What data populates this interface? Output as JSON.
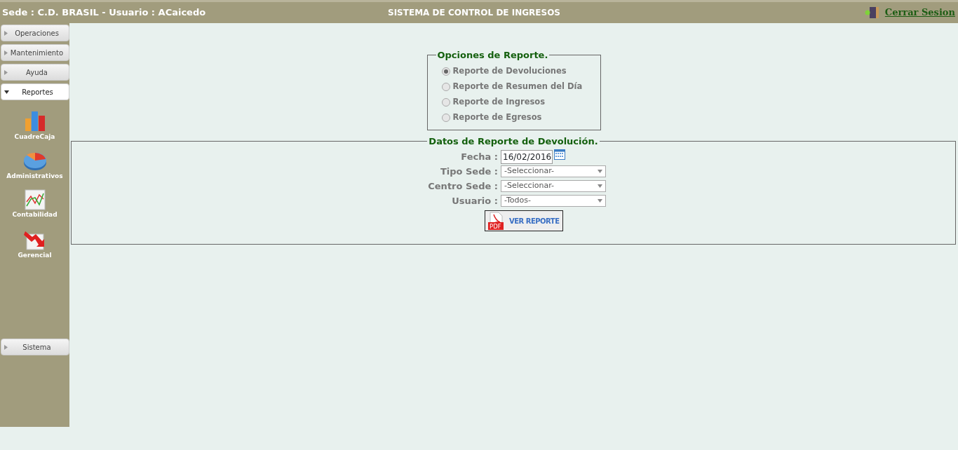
{
  "header": {
    "session": "Sede : C.D. BRASIL - Usuario : ACaicedo",
    "title": "SISTEMA DE CONTROL DE INGRESOS",
    "logout": "Cerrar Sesion"
  },
  "sidebar": {
    "sections": [
      {
        "label": "Operaciones",
        "expanded": false
      },
      {
        "label": "Mantenimiento",
        "expanded": false
      },
      {
        "label": "Ayuda",
        "expanded": false
      },
      {
        "label": "Reportes",
        "expanded": true,
        "items": [
          {
            "label": "CuadreCaja",
            "kind": "bars"
          },
          {
            "label": "Administrativos",
            "kind": "pie"
          },
          {
            "label": "Contabilidad",
            "kind": "line"
          },
          {
            "label": "Gerencial",
            "kind": "down"
          }
        ]
      }
    ],
    "bottom": {
      "label": "Sistema",
      "expanded": false
    }
  },
  "options": {
    "legend": "Opciones de Reporte.",
    "radios": [
      {
        "label": "Reporte de Devoluciones",
        "selected": true
      },
      {
        "label": "Reporte de Resumen del Día",
        "selected": false
      },
      {
        "label": "Reporte de Ingresos",
        "selected": false
      },
      {
        "label": "Reporte de Egresos",
        "selected": false
      }
    ]
  },
  "form": {
    "legend": "Datos de Reporte de Devolución.",
    "fields": [
      {
        "label": "Fecha :",
        "kind": "date",
        "value": "16/02/2016"
      },
      {
        "label": "Tipo Sede :",
        "kind": "select",
        "value": "-Seleccionar-"
      },
      {
        "label": "Centro Sede :",
        "kind": "select",
        "value": "-Seleccionar-"
      },
      {
        "label": "Usuario :",
        "kind": "select",
        "value": "-Todos-"
      }
    ],
    "button": {
      "icon_label": "PDF",
      "label": "VER REPORTE"
    }
  }
}
